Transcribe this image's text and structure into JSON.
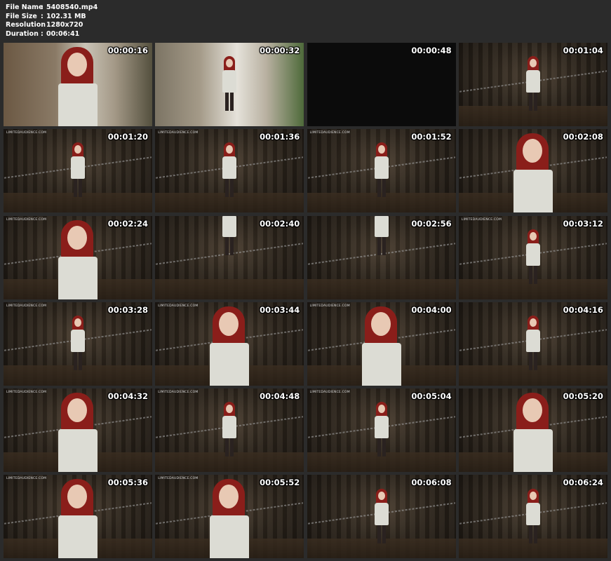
{
  "file_info": {
    "rows": [
      {
        "key": "File Name",
        "value": "5408540.mp4"
      },
      {
        "key": "File Size",
        "value": "102.31 MB"
      },
      {
        "key": "Resolution",
        "value": "1280x720"
      },
      {
        "key": "Duration",
        "value": "00:06:41"
      }
    ],
    "separator": ":"
  },
  "thumbnails": [
    {
      "timestamp": "00:00:16",
      "watermark": "",
      "scene": "outdoor-closeup"
    },
    {
      "timestamp": "00:00:32",
      "watermark": "",
      "scene": "outdoor-wide"
    },
    {
      "timestamp": "00:00:48",
      "watermark": "",
      "scene": "black"
    },
    {
      "timestamp": "00:01:04",
      "watermark": "",
      "scene": "indoor-wide"
    },
    {
      "timestamp": "00:01:20",
      "watermark": "LIMITEDAUDIENCE.COM",
      "scene": "indoor-wide"
    },
    {
      "timestamp": "00:01:36",
      "watermark": "LIMITEDAUDIENCE.COM",
      "scene": "indoor-wide"
    },
    {
      "timestamp": "00:01:52",
      "watermark": "LIMITEDAUDIENCE.COM",
      "scene": "indoor-wide"
    },
    {
      "timestamp": "00:02:08",
      "watermark": "",
      "scene": "indoor-closeup"
    },
    {
      "timestamp": "00:02:24",
      "watermark": "LIMITEDAUDIENCE.COM",
      "scene": "indoor-closeup"
    },
    {
      "timestamp": "00:02:40",
      "watermark": "",
      "scene": "indoor-legs"
    },
    {
      "timestamp": "00:02:56",
      "watermark": "",
      "scene": "indoor-legs"
    },
    {
      "timestamp": "00:03:12",
      "watermark": "LIMITEDAUDIENCE.COM",
      "scene": "indoor-wide"
    },
    {
      "timestamp": "00:03:28",
      "watermark": "LIMITEDAUDIENCE.COM",
      "scene": "indoor-wide"
    },
    {
      "timestamp": "00:03:44",
      "watermark": "LIMITEDAUDIENCE.COM",
      "scene": "indoor-closeup"
    },
    {
      "timestamp": "00:04:00",
      "watermark": "LIMITEDAUDIENCE.COM",
      "scene": "indoor-closeup"
    },
    {
      "timestamp": "00:04:16",
      "watermark": "",
      "scene": "indoor-wide"
    },
    {
      "timestamp": "00:04:32",
      "watermark": "LIMITEDAUDIENCE.COM",
      "scene": "indoor-closeup"
    },
    {
      "timestamp": "00:04:48",
      "watermark": "LIMITEDAUDIENCE.COM",
      "scene": "indoor-wide"
    },
    {
      "timestamp": "00:05:04",
      "watermark": "LIMITEDAUDIENCE.COM",
      "scene": "indoor-wide"
    },
    {
      "timestamp": "00:05:20",
      "watermark": "",
      "scene": "indoor-closeup"
    },
    {
      "timestamp": "00:05:36",
      "watermark": "LIMITEDAUDIENCE.COM",
      "scene": "indoor-closeup"
    },
    {
      "timestamp": "00:05:52",
      "watermark": "LIMITEDAUDIENCE.COM",
      "scene": "indoor-closeup"
    },
    {
      "timestamp": "00:06:08",
      "watermark": "",
      "scene": "indoor-wide"
    },
    {
      "timestamp": "00:06:24",
      "watermark": "",
      "scene": "indoor-wide"
    }
  ],
  "colors": {
    "background": "#2b2b2b",
    "text": "#ffffff",
    "hair": "#8a1e1a",
    "dress": "#dcdcd4"
  }
}
